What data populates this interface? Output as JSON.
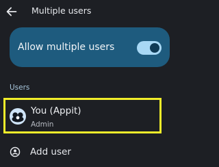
{
  "header": {
    "title": "Multiple users",
    "back_icon": "arrow-left-icon"
  },
  "allow_multiple": {
    "label": "Allow multiple users",
    "enabled": true
  },
  "users_section": {
    "header": "Users",
    "current_user": {
      "name": "You (Appit)",
      "role": "Admin",
      "avatar_icon": "user-avatar-icon"
    },
    "add_user": {
      "label": "Add user",
      "icon": "add-user-icon"
    }
  },
  "colors": {
    "background": "#1d1f24",
    "card": "#1e5b7e",
    "toggle_track": "#a8d8f5",
    "toggle_thumb": "#0f3a55",
    "highlight": "#f2ee2a",
    "section_header": "#a9c8de"
  }
}
